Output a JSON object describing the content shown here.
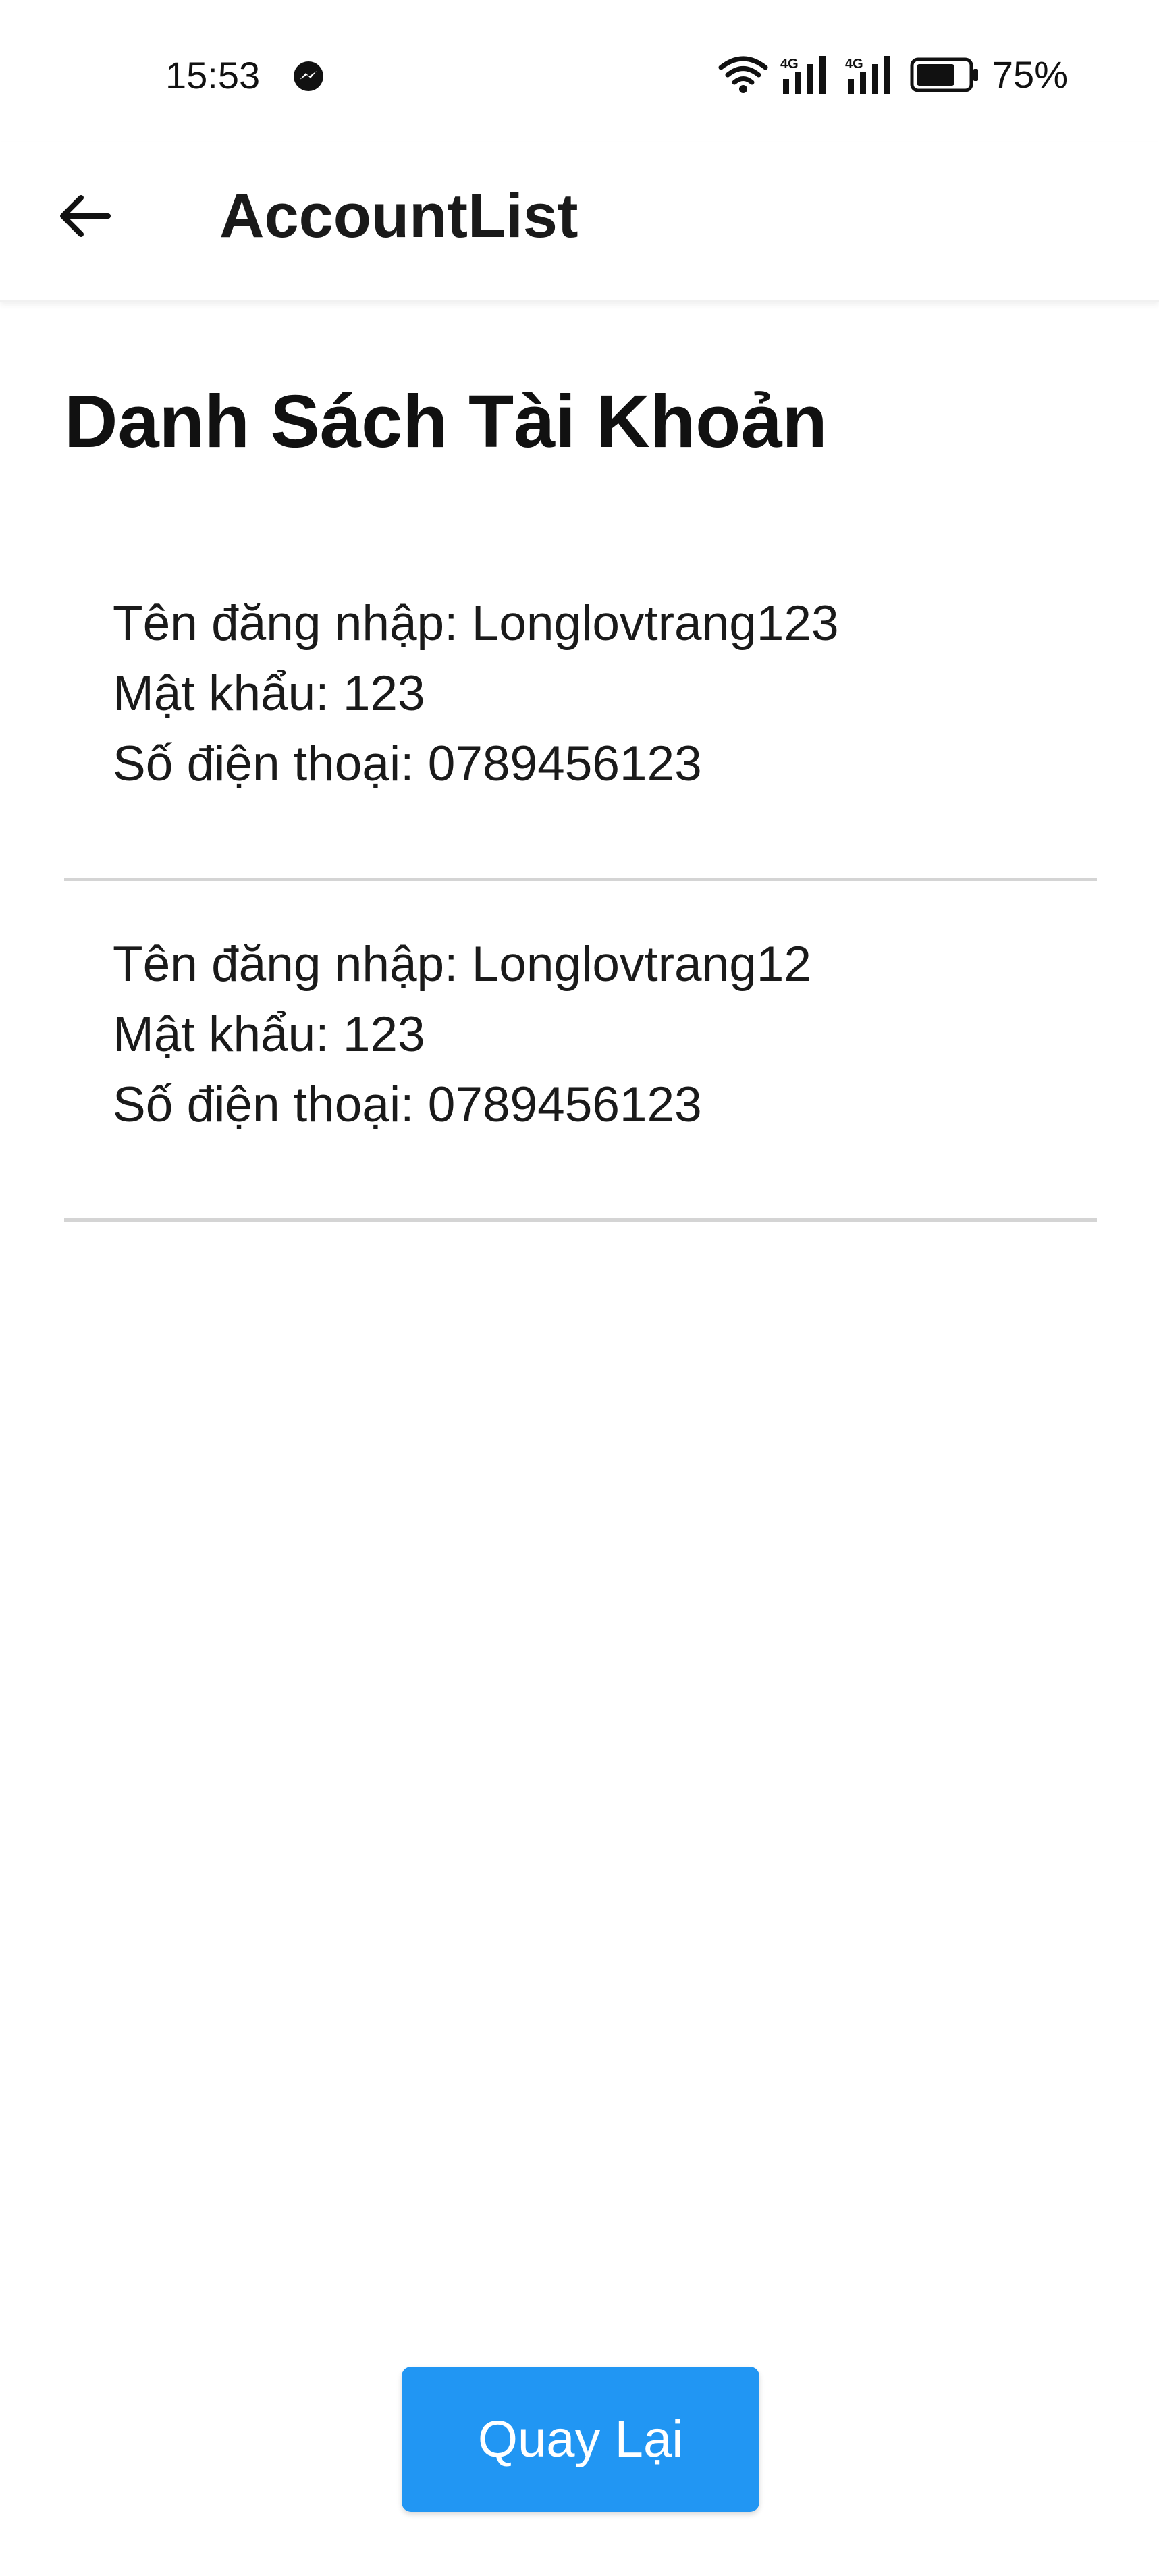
{
  "status_bar": {
    "time": "15:53",
    "battery_percent": "75%",
    "battery_level": 0.75,
    "icons": [
      "messenger-icon",
      "wifi-icon",
      "signal-4g-icon",
      "signal-4g-icon",
      "battery-icon"
    ],
    "signal_label": "4G"
  },
  "app_bar": {
    "title": "AccountList",
    "back_icon": "arrow-left-icon"
  },
  "main": {
    "heading": "Danh Sách Tài Khoản",
    "accounts": [
      {
        "username_line": "Tên đăng nhập: Longlovtrang123",
        "password_line": "Mật khẩu: 123",
        "phone_line": "Số điện thoại: 0789456123"
      },
      {
        "username_line": "Tên đăng nhập: Longlovtrang12",
        "password_line": "Mật khẩu: 123",
        "phone_line": "Số điện thoại: 0789456123"
      }
    ]
  },
  "footer": {
    "back_button_label": "Quay Lại"
  },
  "colors": {
    "primary_button": "#2196f3",
    "divider": "#d4d4d4",
    "text": "#111111",
    "background": "#ffffff"
  }
}
